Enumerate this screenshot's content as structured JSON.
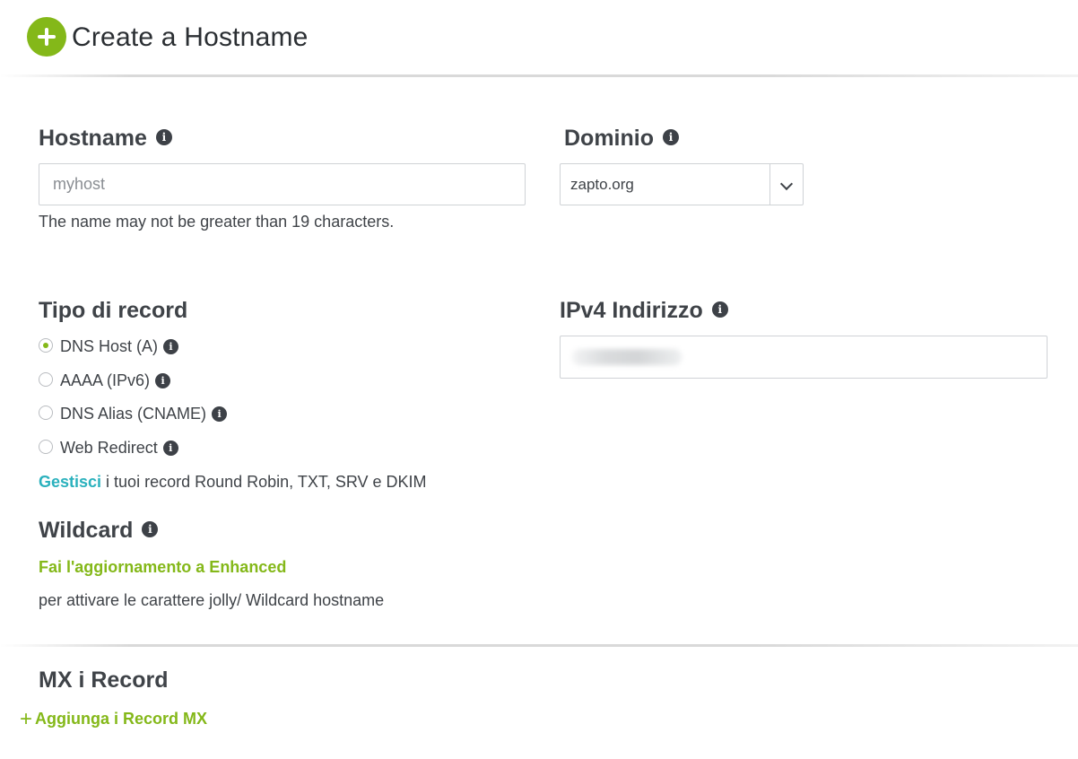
{
  "header": {
    "title": "Create a Hostname"
  },
  "hostname": {
    "label": "Hostname",
    "value": "",
    "placeholder": "myhost",
    "hint": "The name may not be greater than 19 characters."
  },
  "domain": {
    "label": "Dominio",
    "selected": "zapto.org"
  },
  "record_type": {
    "label": "Tipo di record",
    "options": [
      {
        "label": "DNS Host (A)",
        "checked": true
      },
      {
        "label": "AAAA (IPv6)",
        "checked": false
      },
      {
        "label": "DNS Alias (CNAME)",
        "checked": false
      },
      {
        "label": "Web Redirect",
        "checked": false
      }
    ],
    "manage_link": "Gestisci",
    "manage_text": " i tuoi record Round Robin, TXT, SRV e DKIM"
  },
  "ipv4": {
    "label": "IPv4 Indirizzo"
  },
  "wildcard": {
    "label": "Wildcard",
    "upgrade_link": "Fai l'aggiornamento a Enhanced",
    "description": "per attivare le carattere jolly/ Wildcard hostname"
  },
  "mx": {
    "label": "MX i Record",
    "add_link": "Aggiunga i Record MX"
  },
  "colors": {
    "accent_green": "#84b819",
    "link_teal": "#2ab1bd",
    "text": "#3f4348"
  }
}
